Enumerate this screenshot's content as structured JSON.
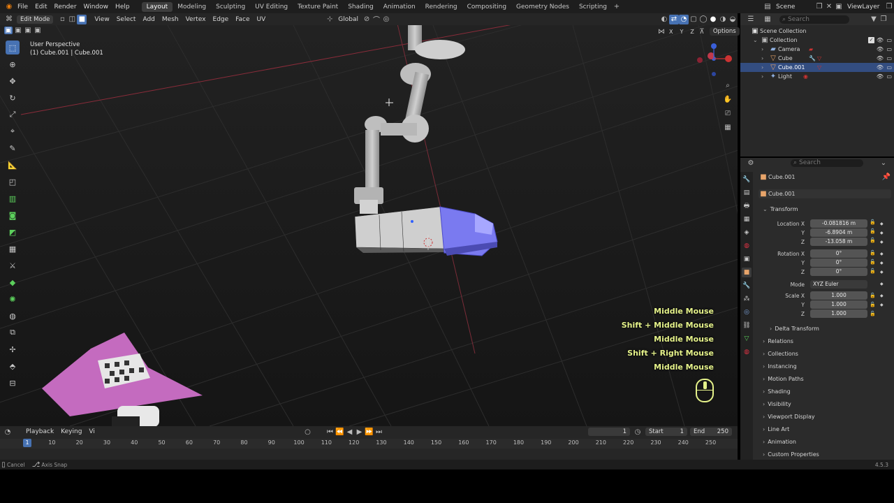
{
  "topbar": {
    "menus": [
      "File",
      "Edit",
      "Render",
      "Window",
      "Help"
    ],
    "workspaces": [
      "Layout",
      "Modeling",
      "Sculpting",
      "UV Editing",
      "Texture Paint",
      "Shading",
      "Animation",
      "Rendering",
      "Compositing",
      "Geometry Nodes",
      "Scripting"
    ],
    "active_workspace": "Layout",
    "scene": "Scene",
    "view_layer": "ViewLayer"
  },
  "viewport_header": {
    "mode": "Edit Mode",
    "menus": [
      "View",
      "Select",
      "Add",
      "Mesh",
      "Vertex",
      "Edge",
      "Face",
      "UV"
    ],
    "orientation": "Global",
    "axes": [
      "X",
      "Y",
      "Z"
    ],
    "options": "Options"
  },
  "viewport": {
    "view_name": "User Perspective",
    "object_info": "(1) Cube.001 | Cube.001"
  },
  "keystrokes": [
    "Middle Mouse",
    "Shift + Middle Mouse",
    "Middle Mouse",
    "Shift + Right Mouse",
    "Middle Mouse"
  ],
  "timeline": {
    "playback": "Playback",
    "keying": "Keying",
    "view": "Vi",
    "current_frame": "1",
    "start_label": "Start",
    "start": "1",
    "end_label": "End",
    "end": "250",
    "ruler": [
      "10",
      "20",
      "30",
      "40",
      "50",
      "60",
      "70",
      "80",
      "90",
      "100",
      "110",
      "120",
      "130",
      "140",
      "150",
      "160",
      "170",
      "180",
      "190",
      "200",
      "210",
      "220",
      "230",
      "240",
      "250"
    ],
    "playhead": "1"
  },
  "statusbar": {
    "cancel": "Cancel",
    "axis_snap": "Axis Snap",
    "version": "4.5.3"
  },
  "outliner": {
    "search_placeholder": "Search",
    "items": [
      {
        "label": "Scene Collection"
      },
      {
        "label": "Collection"
      },
      {
        "label": "Camera"
      },
      {
        "label": "Cube"
      },
      {
        "label": "Cube.001"
      },
      {
        "label": "Light"
      }
    ]
  },
  "properties": {
    "search_placeholder": "Search",
    "object_name": "Cube.001",
    "object_field": "Cube.001",
    "transform_label": "Transform",
    "location_label": "Location X",
    "location": [
      "-0.081816 m",
      "-6.8904 m",
      "-13.058 m"
    ],
    "rotation_label": "Rotation X",
    "rotation": [
      "0°",
      "0°",
      "0°"
    ],
    "mode_label": "Mode",
    "mode_value": "XYZ Euler",
    "scale_label": "Scale X",
    "scale": [
      "1.000",
      "1.000",
      "1.000"
    ],
    "y_label": "Y",
    "z_label": "Z",
    "delta_transform": "Delta Transform",
    "panels": [
      "Relations",
      "Collections",
      "Instancing",
      "Motion Paths",
      "Shading",
      "Visibility",
      "Viewport Display",
      "Line Art",
      "Animation",
      "Custom Properties"
    ]
  },
  "colors": {
    "accent": "#4772b3",
    "selection": "#334d80",
    "keystroke": "#e5f28a",
    "mesh_selected": "#6a6ae8"
  }
}
